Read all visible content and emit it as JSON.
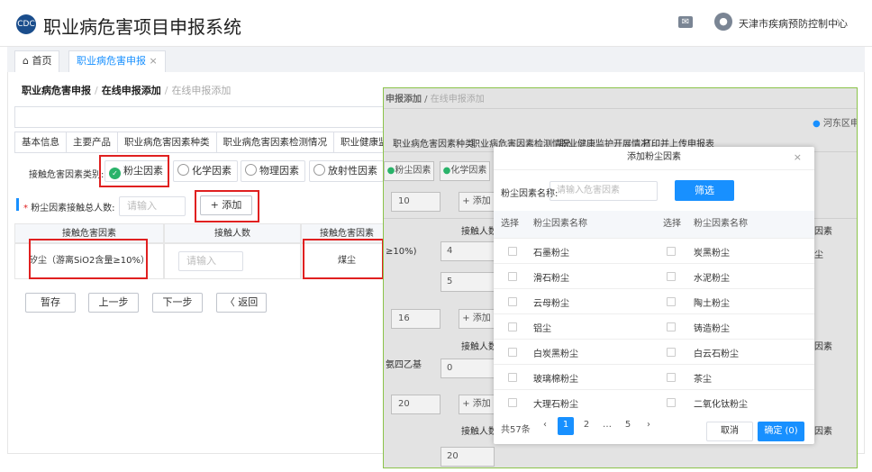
{
  "app": {
    "title": "职业病危害项目申报系统",
    "user": "天津市疾病预防控制中心"
  },
  "tabs": {
    "home": "首页",
    "active": "职业病危害申报",
    "close": "×"
  },
  "breadcrumb": {
    "a": "职业病危害申报",
    "b": "在线申报添加",
    "c": "在线申报添加"
  },
  "subtabs": [
    "基本信息",
    "主要产品",
    "职业病危害因素种类",
    "职业病危害因素检测情况",
    "职业健康监护开展"
  ],
  "hazard": {
    "label": "接触危害因素类别:",
    "options": [
      "粉尘因素",
      "化学因素",
      "物理因素",
      "放射性因素"
    ]
  },
  "total": {
    "label": "粉尘因素接触总人数:",
    "placeholder": "请输入",
    "add": "+ 添加"
  },
  "grid": {
    "headers": [
      "接触危害因素",
      "接触人数",
      "接触危害因素"
    ],
    "factor": "矽尘（游离SiO2含量≥10%）",
    "count_placeholder": "请输入",
    "factor2": "煤尘"
  },
  "actions": {
    "save": "暂存",
    "prev": "上一步",
    "next": "下一步",
    "back": "〈 返回"
  },
  "bg": {
    "bc1": "申报添加",
    "bc2": "在线申报添加",
    "district": "河东区申报",
    "tabs": [
      "职业病危害因素种类",
      "职业病危害因素检测情况",
      "职业健康监护开展情况",
      "打印并上传申报表"
    ],
    "chip1": "粉尘因素",
    "chip2": "化学因素",
    "v10": "10",
    "add": "+ 添加",
    "hdcount": "接触人数",
    "hdfactor": "因素",
    "r1": "≥10%)",
    "v4": "4",
    "v5": "5",
    "v16": "16",
    "r2": "氨四乙基",
    "v0": "0",
    "v20": "20",
    "v20b": "20",
    "dust": "尘"
  },
  "dialog": {
    "title": "添加粉尘因素",
    "close": "×",
    "label": "粉尘因素名称:",
    "placeholder": "请输入危害因素",
    "filter": "筛选",
    "col_select": "选择",
    "col_name": "粉尘因素名称",
    "rows": [
      [
        "石墨粉尘",
        "炭黑粉尘"
      ],
      [
        "滑石粉尘",
        "水泥粉尘"
      ],
      [
        "云母粉尘",
        "陶土粉尘"
      ],
      [
        "铝尘",
        "铸造粉尘"
      ],
      [
        "白炭黑粉尘",
        "白云石粉尘"
      ],
      [
        "玻璃棉粉尘",
        "茶尘"
      ],
      [
        "大理石粉尘",
        "二氧化钛粉尘"
      ]
    ],
    "total": "共57条",
    "pages": [
      "‹",
      "1",
      "2",
      "…",
      "5",
      "›"
    ],
    "cancel": "取消",
    "ok": "确定 (0)"
  }
}
